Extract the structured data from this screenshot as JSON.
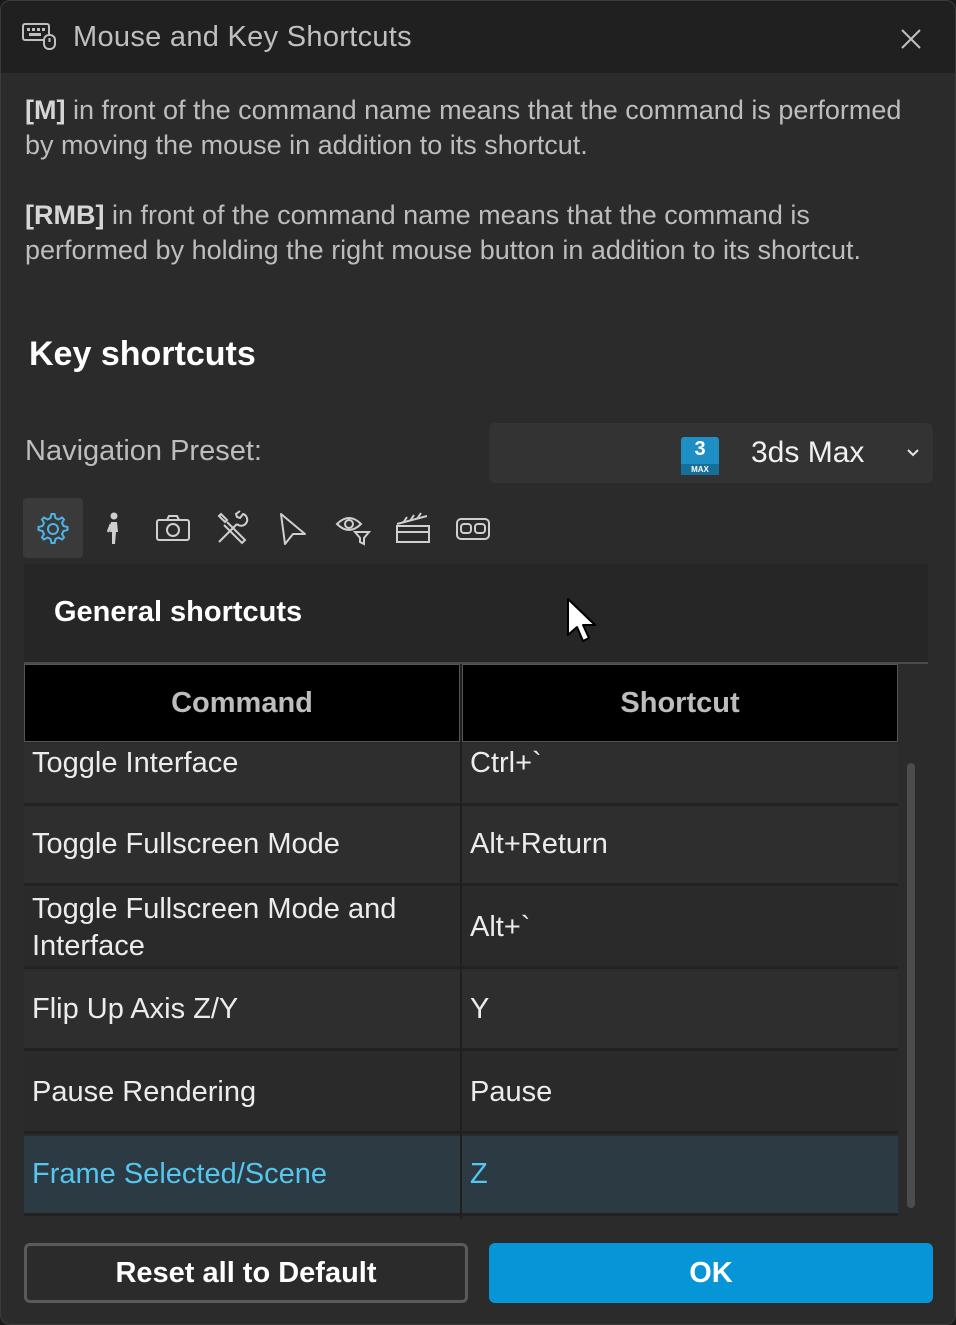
{
  "window": {
    "title": "Mouse and Key Shortcuts"
  },
  "info": {
    "m_tag": "[M]",
    "m_text": " in front of the command name means that the command is performed by moving the mouse in addition to its shortcut.",
    "rmb_tag": "[RMB]",
    "rmb_text": " in front of the command name means that the command is performed by holding the right mouse button in addition to its shortcut."
  },
  "section_title": "Key shortcuts",
  "navigation": {
    "label": "Navigation Preset:",
    "selected": "3ds Max",
    "logo_num": "3",
    "logo_text": "MAX"
  },
  "tabs": [
    {
      "icon": "gear-icon"
    },
    {
      "icon": "walk-icon"
    },
    {
      "icon": "camera-icon"
    },
    {
      "icon": "tools-icon"
    },
    {
      "icon": "select-arrow-icon"
    },
    {
      "icon": "view-filter-icon"
    },
    {
      "icon": "clapperboard-icon"
    },
    {
      "icon": "vr-headset-icon"
    }
  ],
  "panel_title": "General shortcuts",
  "table": {
    "headers": {
      "command": "Command",
      "shortcut": "Shortcut"
    },
    "rows": [
      {
        "command": "Toggle Interface",
        "shortcut": "Ctrl+`"
      },
      {
        "command": "Toggle Fullscreen Mode",
        "shortcut": "Alt+Return"
      },
      {
        "command": "Toggle Fullscreen Mode and Interface",
        "shortcut": "Alt+`"
      },
      {
        "command": "Flip Up Axis Z/Y",
        "shortcut": "Y"
      },
      {
        "command": "Pause Rendering",
        "shortcut": "Pause"
      },
      {
        "command": "Frame Selected/Scene",
        "shortcut": "Z",
        "selected": true
      }
    ]
  },
  "buttons": {
    "reset": "Reset all to Default",
    "ok": "OK"
  },
  "colors": {
    "accent": "#0696d7",
    "selected_text": "#55c6ee",
    "background": "#2b2b2b"
  }
}
